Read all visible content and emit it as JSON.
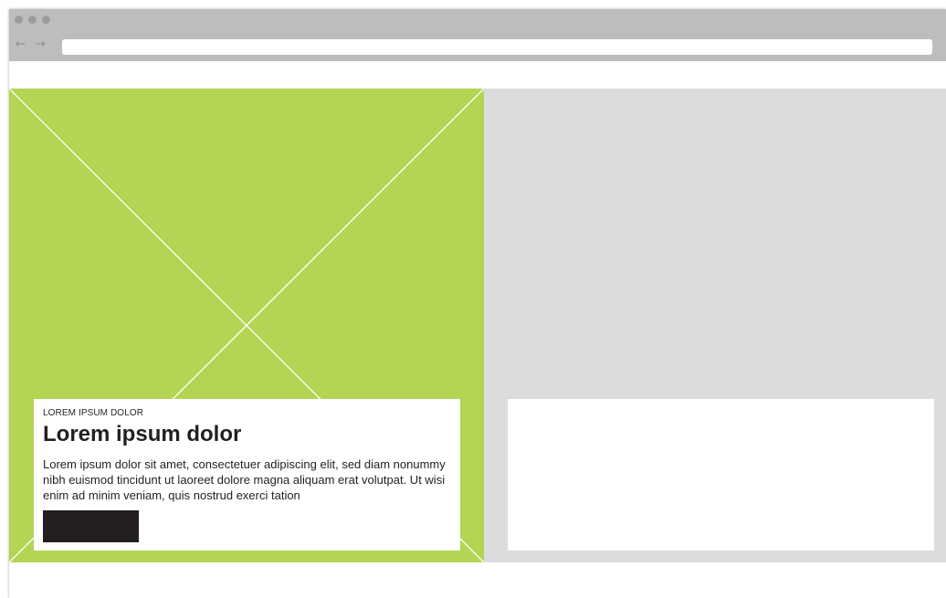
{
  "browser": {
    "url": "",
    "back_icon": "arrow-left-icon",
    "forward_icon": "arrow-right-icon",
    "window_controls": [
      "close",
      "minimize",
      "maximize"
    ]
  },
  "colors": {
    "chrome": "#bdbdbd",
    "image_placeholder": "#b3d553",
    "right_panel": "#dcdbdd",
    "button": "#231f20",
    "text": "#231f20"
  },
  "feature_card": {
    "eyebrow": "LOREM IPSUM DOLOR",
    "title": "Lorem ipsum dolor",
    "body": "Lorem ipsum dolor sit amet, consectetuer adipiscing elit, sed diam nonummy nibh euismod tincidunt ut laoreet dolore magna aliquam erat volutpat. Ut wisi enim ad minim veniam, quis nostrud exerci tation",
    "button_label": ""
  },
  "secondary_card": {
    "content": ""
  }
}
